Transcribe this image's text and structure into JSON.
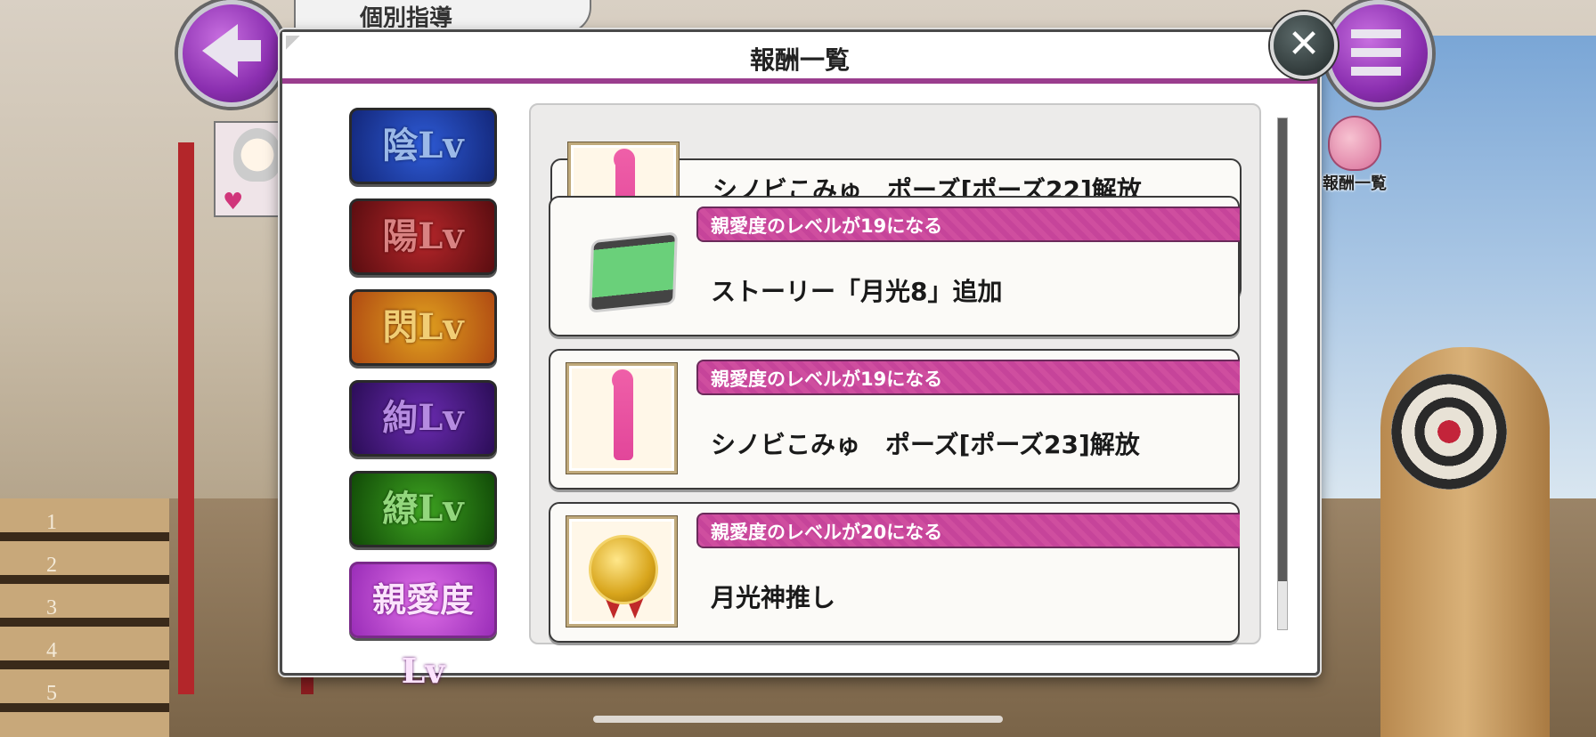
{
  "screen": {
    "title_tab": "個別指導",
    "step_numbers": [
      "1",
      "2",
      "3",
      "4",
      "5"
    ]
  },
  "hud": {
    "back_icon": "arrow-left-icon",
    "menu_icon": "hamburger-menu-icon",
    "reward_shortcut_label": "報酬一覧"
  },
  "modal": {
    "title": "報酬一覧",
    "close_icon": "close-icon"
  },
  "tabs": [
    {
      "label": "陰Lv",
      "color": "#1e3fa6"
    },
    {
      "label": "陽Lv",
      "color": "#8a1518"
    },
    {
      "label": "閃Lv",
      "color": "#c8731a"
    },
    {
      "label": "絢Lv",
      "color": "#4a1c86"
    },
    {
      "label": "繚Lv",
      "color": "#27761a"
    },
    {
      "label": "親愛度Lv",
      "color": "#c857d8",
      "selected": true
    }
  ],
  "rewards": [
    {
      "condition": "",
      "text": "シノビこみゅ　ポーズ[ポーズ22]解放",
      "icon": "pose-figure-icon"
    },
    {
      "condition": "親愛度のレベルが19になる",
      "text": "ストーリー「月光8」追加",
      "icon": "film-strip-icon"
    },
    {
      "condition": "親愛度のレベルが19になる",
      "text": "シノビこみゅ　ポーズ[ポーズ23]解放",
      "icon": "pose-figure-icon"
    },
    {
      "condition": "親愛度のレベルが20になる",
      "text": "月光神推し",
      "icon": "gold-medal-icon"
    }
  ],
  "colors": {
    "accent_purple": "#9a3d8e",
    "condition_bar": "#cf4e9f"
  }
}
